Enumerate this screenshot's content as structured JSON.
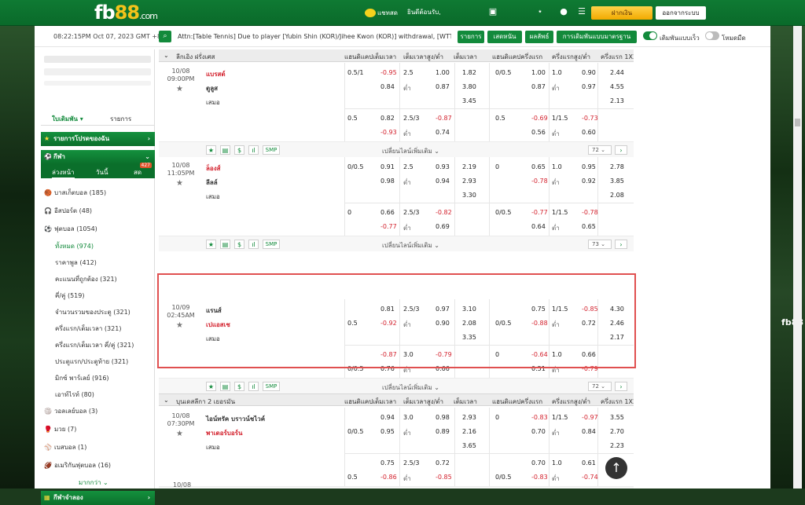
{
  "brand": {
    "name": "fb",
    "num": "88",
    "tld": ".com",
    "side_logo": "fb88"
  },
  "header": {
    "chat": "แชทสด",
    "welcome": "ยินดีต้อนรับ,",
    "deposit": "ฝากเงิน",
    "logout": "ออกจากระบบ"
  },
  "infobar": {
    "clock": "08:22:15PM Oct 07, 2023 GMT +8",
    "ticker": "Attn:[Table Tennis] Due to player [Yubin Shin (KOR)/Jihee Kwon (KOR)] withdrawal, [WTT Star",
    "btn1": "รายการ",
    "btn2": "เสดหนัน",
    "btn3": "ผลลัพธ์",
    "btn4": "การเดิมพันแบบมาตรฐาน",
    "toggle1": "เดิมพันแบบเร็ว",
    "toggle2": "โหมดมืด"
  },
  "sidebar": {
    "menu_left": "ใบเดิมพัน",
    "menu_right": "รายการ",
    "favorites": "รายการโปรดของฉัน",
    "sports": "กีฬา",
    "tab1": "ล่วงหน้า",
    "tab2": "วันนี้",
    "tab3": "สด",
    "tab3_count": "427",
    "items": [
      {
        "icon": "🏀",
        "label": "บาสเก็ตบอล",
        "count": "(185)"
      },
      {
        "icon": "🎧",
        "label": "อีสปอร์ต",
        "count": "(48)"
      },
      {
        "icon": "⚽",
        "label": "ฟุตบอล",
        "count": "(1054)"
      }
    ],
    "subitems": [
      {
        "label": "ทั้งหมด",
        "count": "(974)"
      },
      {
        "label": "ราคาพูล",
        "count": "(412)"
      },
      {
        "label": "คะแนนที่ถูกต้อง",
        "count": "(321)"
      },
      {
        "label": "คี่/คู่",
        "count": "(519)"
      },
      {
        "label": "จำนวนรวมของประตู",
        "count": "(321)"
      },
      {
        "label": "ครึ่งแรก/เต็มเวลา",
        "count": "(321)"
      },
      {
        "label": "ครึ่งแรก/เต็มเวลา คี่/คู่",
        "count": "(321)"
      },
      {
        "label": "ประตูแรก/ประตูท้าย",
        "count": "(321)"
      },
      {
        "label": "มิกซ์ พาร์เลย์",
        "count": "(916)"
      },
      {
        "label": "เอาท์ไรท์",
        "count": "(80)"
      }
    ],
    "items2": [
      {
        "icon": "🏐",
        "label": "วอลเลย์บอล",
        "count": "(3)"
      },
      {
        "icon": "🥊",
        "label": "มวย",
        "count": "(7)"
      },
      {
        "icon": "⚾",
        "label": "เบสบอล",
        "count": "(1)"
      },
      {
        "icon": "🏈",
        "label": "อเมริกันฟุตบอล",
        "count": "(16)"
      }
    ],
    "more": "มากกว่า",
    "virtual": "กีฬาจำลอง"
  },
  "columns": {
    "league": "ลีกเอิง ฝรั่งเศส",
    "h1": "แฮนดิแคปเต็มเวลา",
    "h2": "เต็มเวลาสูง/ต่ำ",
    "h3": "เต็มเวลา",
    "h4": "แฮนดิแคปครึ่งแรก",
    "h5": "ครึ่งแรกสูง/ต่ำ",
    "h6": "ครึ่งแรก 1X2"
  },
  "league2": {
    "name": "บุนเดสลีกา 2 เยอรมัน",
    "h1": "แฮนดิแคปเต็มเวลา",
    "h2": "เต็มเวลาสูง/ต่ำ",
    "h3": "เต็มเวลา",
    "h4": "แฮนดิแคปครึ่งแรก",
    "h5": "ครึ่งแรกสูง/ต่ำ",
    "h6": "ครึ่งแรก 1X2"
  },
  "actions": {
    "smp": "SMP",
    "more_lines": "เปลี่ยนไลน์เพิ่มเติม",
    "under": "ต่ำ",
    "draw": "เสมอ"
  },
  "matches": [
    {
      "date": "10/08",
      "time": "09:00PM",
      "home": "แบรสต์",
      "away": "ตูลูส",
      "home_red": true,
      "r1": {
        "hc": "0.5/1",
        "hco": "-0.95",
        "ou": "2.5",
        "ouo": "1.00",
        "x1": "1.82",
        "fhc": "0/0.5",
        "fhco": "1.00",
        "fou": "1.0",
        "fouo": "0.90",
        "fx": "2.44"
      },
      "r2": {
        "hc": "",
        "hco": "0.84",
        "ou": "ต่ำ",
        "ouo": "0.87",
        "x1": "3.80",
        "fhc": "",
        "fhco": "0.87",
        "fou": "ต่ำ",
        "fouo": "0.97",
        "fx": "4.55"
      },
      "r3": {
        "x1": "3.45",
        "fx": "2.13"
      },
      "s1": {
        "hc": "0.5",
        "hco": "0.82",
        "ou": "2.5/3",
        "ouo": "-0.87",
        "fhc": "0.5",
        "fhco": "-0.69",
        "fou": "1/1.5",
        "fouo": "-0.73"
      },
      "s2": {
        "hc": "",
        "hco": "-0.93",
        "ou": "ต่ำ",
        "ouo": "0.74",
        "fhc": "",
        "fhco": "0.56",
        "fou": "ต่ำ",
        "fouo": "0.60"
      },
      "count": "72"
    },
    {
      "date": "10/08",
      "time": "11:05PM",
      "home": "ล็องส์",
      "away": "ลีลล์",
      "home_red": true,
      "r1": {
        "hc": "0/0.5",
        "hco": "0.91",
        "ou": "2.5",
        "ouo": "0.93",
        "x1": "2.19",
        "fhc": "0",
        "fhco": "0.65",
        "fou": "1.0",
        "fouo": "0.95",
        "fx": "2.78"
      },
      "r2": {
        "hc": "",
        "hco": "0.98",
        "ou": "ต่ำ",
        "ouo": "0.94",
        "x1": "2.93",
        "fhc": "",
        "fhco": "-0.78",
        "fou": "ต่ำ",
        "fouo": "0.92",
        "fx": "3.85"
      },
      "r3": {
        "x1": "3.30",
        "fx": "2.08"
      },
      "s1": {
        "hc": "0",
        "hco": "0.66",
        "ou": "2.5/3",
        "ouo": "-0.82",
        "fhc": "0/0.5",
        "fhco": "-0.77",
        "fou": "1/1.5",
        "fouo": "-0.78"
      },
      "s2": {
        "hc": "",
        "hco": "-0.77",
        "ou": "ต่ำ",
        "ouo": "0.69",
        "fhc": "",
        "fhco": "0.64",
        "fou": "ต่ำ",
        "fouo": "0.65"
      },
      "count": "73"
    },
    {
      "date": "10/09",
      "time": "02:45AM",
      "home": "แรนส์",
      "away": "เปแอสเช",
      "home_red": false,
      "r1": {
        "hc": "",
        "hco": "0.81",
        "ou": "2.5/3",
        "ouo": "0.97",
        "x1": "3.10",
        "fhc": "",
        "fhco": "0.75",
        "fou": "1/1.5",
        "fouo": "-0.85",
        "fx": "4.30"
      },
      "r2": {
        "hc": "0.5",
        "hco": "-0.92",
        "ou": "ต่ำ",
        "ouo": "0.90",
        "x1": "2.08",
        "fhc": "0/0.5",
        "fhco": "-0.88",
        "fou": "ต่ำ",
        "fouo": "0.72",
        "fx": "2.46"
      },
      "r3": {
        "x1": "3.35",
        "fx": "2.17"
      },
      "s1": {
        "hc": "",
        "hco": "-0.87",
        "ou": "3.0",
        "ouo": "-0.79",
        "fhc": "0",
        "fhco": "-0.64",
        "fou": "1.0",
        "fouo": "0.66"
      },
      "s2": {
        "hc": "0/0.5",
        "hco": "0.76",
        "ou": "ต่ำ",
        "ouo": "0.66",
        "fhc": "",
        "fhco": "0.51",
        "fou": "ต่ำ",
        "fouo": "-0.79"
      },
      "count": "72"
    },
    {
      "date": "10/08",
      "time": "07:30PM",
      "home": "ไอน์ทรัค บราวน์ชไวค์",
      "away": "พาเดอร์บอร์น",
      "home_red": false,
      "r1": {
        "hc": "",
        "hco": "0.94",
        "ou": "3.0",
        "ouo": "0.98",
        "x1": "2.93",
        "fhc": "0",
        "fhco": "-0.83",
        "fou": "1/1.5",
        "fouo": "-0.97",
        "fx": "3.55"
      },
      "r2": {
        "hc": "0/0.5",
        "hco": "0.95",
        "ou": "ต่ำ",
        "ouo": "0.89",
        "x1": "2.16",
        "fhc": "",
        "fhco": "0.70",
        "fou": "ต่ำ",
        "fouo": "0.84",
        "fx": "2.70"
      },
      "r3": {
        "x1": "3.65",
        "fx": "2.23"
      },
      "s1": {
        "hc": "",
        "hco": "0.75",
        "ou": "2.5/3",
        "ouo": "0.72",
        "fhc": "",
        "fhco": "0.70",
        "fou": "1.0",
        "fouo": "0.61"
      },
      "s2": {
        "hc": "0.5",
        "hco": "-0.86",
        "ou": "ต่ำ",
        "ouo": "-0.85",
        "fhc": "0/0.5",
        "fhco": "-0.83",
        "fou": "ต่ำ",
        "fouo": "-0.74"
      },
      "count": "70"
    }
  ],
  "peek": {
    "date": "10/08"
  },
  "colors": {
    "green": "#128a3b",
    "red": "#d3212d",
    "gold": "#f2c21b"
  }
}
